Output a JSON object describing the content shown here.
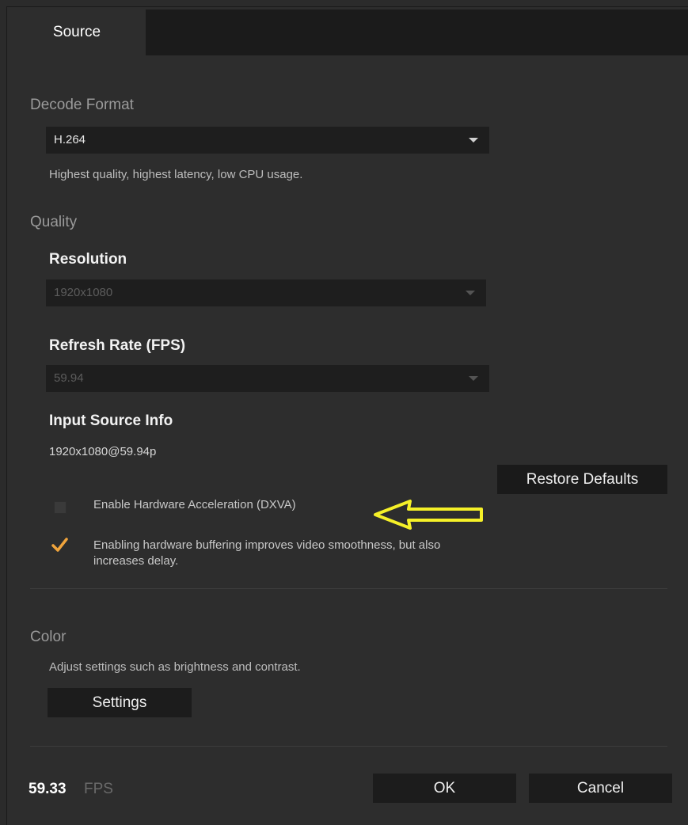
{
  "tabs": [
    {
      "label": "Source"
    }
  ],
  "decode": {
    "title": "Decode Format",
    "selected": "H.264",
    "description": "Highest quality, highest latency, low CPU usage."
  },
  "quality": {
    "title": "Quality",
    "resolution_label": "Resolution",
    "resolution_value": "1920x1080",
    "refresh_label": "Refresh Rate (FPS)",
    "refresh_value": "59.94",
    "input_label": "Input Source Info",
    "input_value": "1920x1080@59.94p",
    "restore_label": "Restore Defaults",
    "hw_accel_label": "Enable Hardware Acceleration (DXVA)",
    "hw_accel_checked": false,
    "buffering_text_line1": "Enabling hardware buffering improves video smoothness, but also",
    "buffering_text_line2": "increases delay.",
    "buffering_checked": true
  },
  "color": {
    "title": "Color",
    "description": "Adjust settings such as brightness and contrast.",
    "settings_label": "Settings"
  },
  "footer": {
    "fps_value": "59.33",
    "fps_unit": "FPS",
    "ok_label": "OK",
    "cancel_label": "Cancel"
  },
  "colors": {
    "background": "#2d2d2d",
    "control": "#1e1e1e",
    "accent_check": "#f0a43c",
    "annotation_arrow": "#f5f028"
  },
  "icons": {
    "dropdown": "chevron-down-icon",
    "checkmark": "checkmark-icon",
    "annotation": "arrow-left-icon"
  }
}
